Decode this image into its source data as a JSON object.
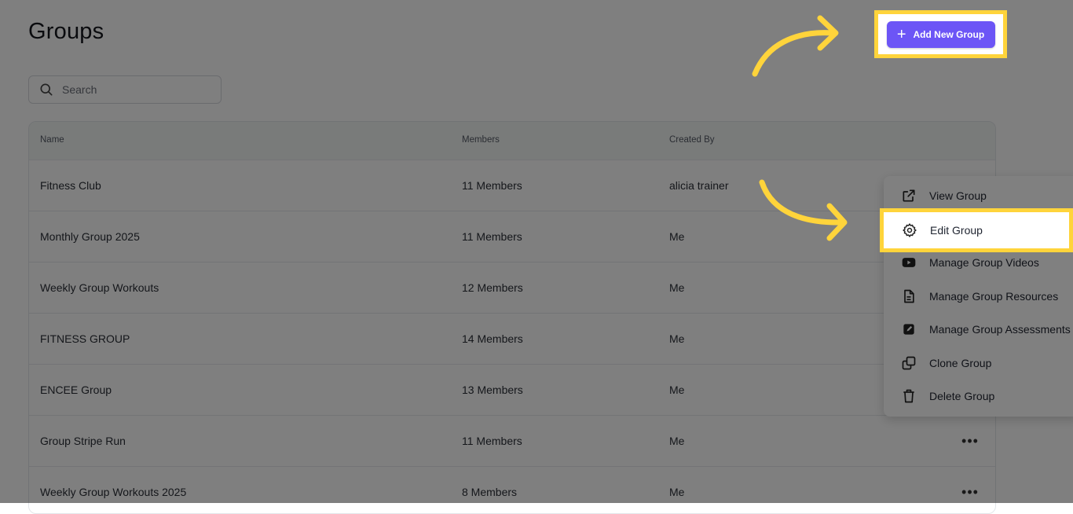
{
  "page": {
    "title": "Groups"
  },
  "search": {
    "placeholder": "Search",
    "value": ""
  },
  "table": {
    "columns": {
      "name": "Name",
      "members": "Members",
      "created_by": "Created By"
    },
    "rows": [
      {
        "name": "Fitness Club",
        "members": "11 Members",
        "created_by": "alicia trainer"
      },
      {
        "name": "Monthly Group 2025",
        "members": "11 Members",
        "created_by": "Me"
      },
      {
        "name": "Weekly Group Workouts",
        "members": "12 Members",
        "created_by": "Me"
      },
      {
        "name": "FITNESS GROUP",
        "members": "14 Members",
        "created_by": "Me"
      },
      {
        "name": "ENCEE Group",
        "members": "13 Members",
        "created_by": "Me"
      },
      {
        "name": "Group Stripe Run",
        "members": "11 Members",
        "created_by": "Me"
      },
      {
        "name": "Weekly Group Workouts 2025",
        "members": "8 Members",
        "created_by": "Me"
      }
    ]
  },
  "actions": {
    "add_new_group": "Add New Group",
    "plus_icon": "plus-icon"
  },
  "context_menu": {
    "items": [
      {
        "label": "View Group",
        "icon": "external-link-icon"
      },
      {
        "label": "Edit Group",
        "icon": "gear-icon"
      },
      {
        "label": "Manage Group Videos",
        "icon": "youtube-icon"
      },
      {
        "label": "Manage Group Resources",
        "icon": "document-icon"
      },
      {
        "label": "Manage Group Assessments",
        "icon": "edit-square-icon"
      },
      {
        "label": "Clone Group",
        "icon": "copy-icon"
      },
      {
        "label": "Delete Group",
        "icon": "trash-icon"
      }
    ]
  },
  "colors": {
    "accent": "#6c55f6",
    "highlight": "#ffd43b",
    "overlay": "rgba(0,0,0,0.5)"
  }
}
